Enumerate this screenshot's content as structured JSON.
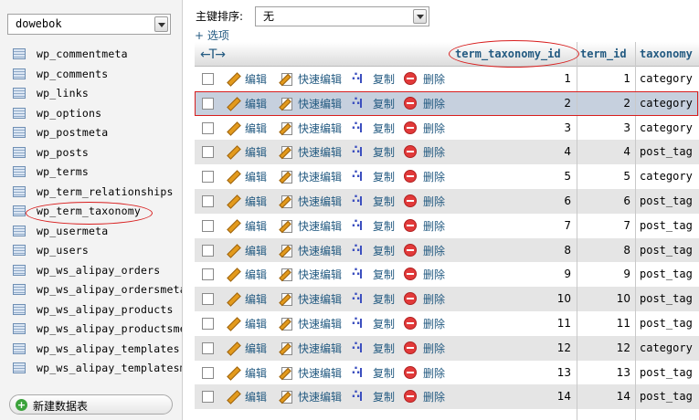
{
  "sidebar": {
    "database": "dowebok",
    "tables": [
      "wp_commentmeta",
      "wp_comments",
      "wp_links",
      "wp_options",
      "wp_postmeta",
      "wp_posts",
      "wp_terms",
      "wp_term_relationships",
      "wp_term_taxonomy",
      "wp_usermeta",
      "wp_users",
      "wp_ws_alipay_orders",
      "wp_ws_alipay_ordersmeta",
      "wp_ws_alipay_products",
      "wp_ws_alipay_productsmeta",
      "wp_ws_alipay_templates",
      "wp_ws_alipay_templatesmeta"
    ],
    "new_table_label": "新建数据表"
  },
  "toolbar": {
    "sort_label": "主键排序:",
    "sort_value": "无",
    "options_label": "+ 选项"
  },
  "grid": {
    "resize_glyph": "←T→",
    "columns": [
      "term_taxonomy_id",
      "term_id",
      "taxonomy"
    ],
    "actions": {
      "edit": "编辑",
      "inline_edit": "快速编辑",
      "copy": "复制",
      "delete": "删除"
    },
    "rows": [
      {
        "term_taxonomy_id": "1",
        "term_id": "1",
        "taxonomy": "category"
      },
      {
        "term_taxonomy_id": "2",
        "term_id": "2",
        "taxonomy": "category"
      },
      {
        "term_taxonomy_id": "3",
        "term_id": "3",
        "taxonomy": "category"
      },
      {
        "term_taxonomy_id": "4",
        "term_id": "4",
        "taxonomy": "post_tag"
      },
      {
        "term_taxonomy_id": "5",
        "term_id": "5",
        "taxonomy": "category"
      },
      {
        "term_taxonomy_id": "6",
        "term_id": "6",
        "taxonomy": "post_tag"
      },
      {
        "term_taxonomy_id": "7",
        "term_id": "7",
        "taxonomy": "post_tag"
      },
      {
        "term_taxonomy_id": "8",
        "term_id": "8",
        "taxonomy": "post_tag"
      },
      {
        "term_taxonomy_id": "9",
        "term_id": "9",
        "taxonomy": "post_tag"
      },
      {
        "term_taxonomy_id": "10",
        "term_id": "10",
        "taxonomy": "post_tag"
      },
      {
        "term_taxonomy_id": "11",
        "term_id": "11",
        "taxonomy": "post_tag"
      },
      {
        "term_taxonomy_id": "12",
        "term_id": "12",
        "taxonomy": "category"
      },
      {
        "term_taxonomy_id": "13",
        "term_id": "13",
        "taxonomy": "post_tag"
      },
      {
        "term_taxonomy_id": "14",
        "term_id": "14",
        "taxonomy": "post_tag"
      }
    ]
  },
  "colors": {
    "link": "#235a81",
    "highlight": "#d81e1e",
    "row_alt": "#e5e5e5",
    "row_selected": "#c6d0de"
  }
}
